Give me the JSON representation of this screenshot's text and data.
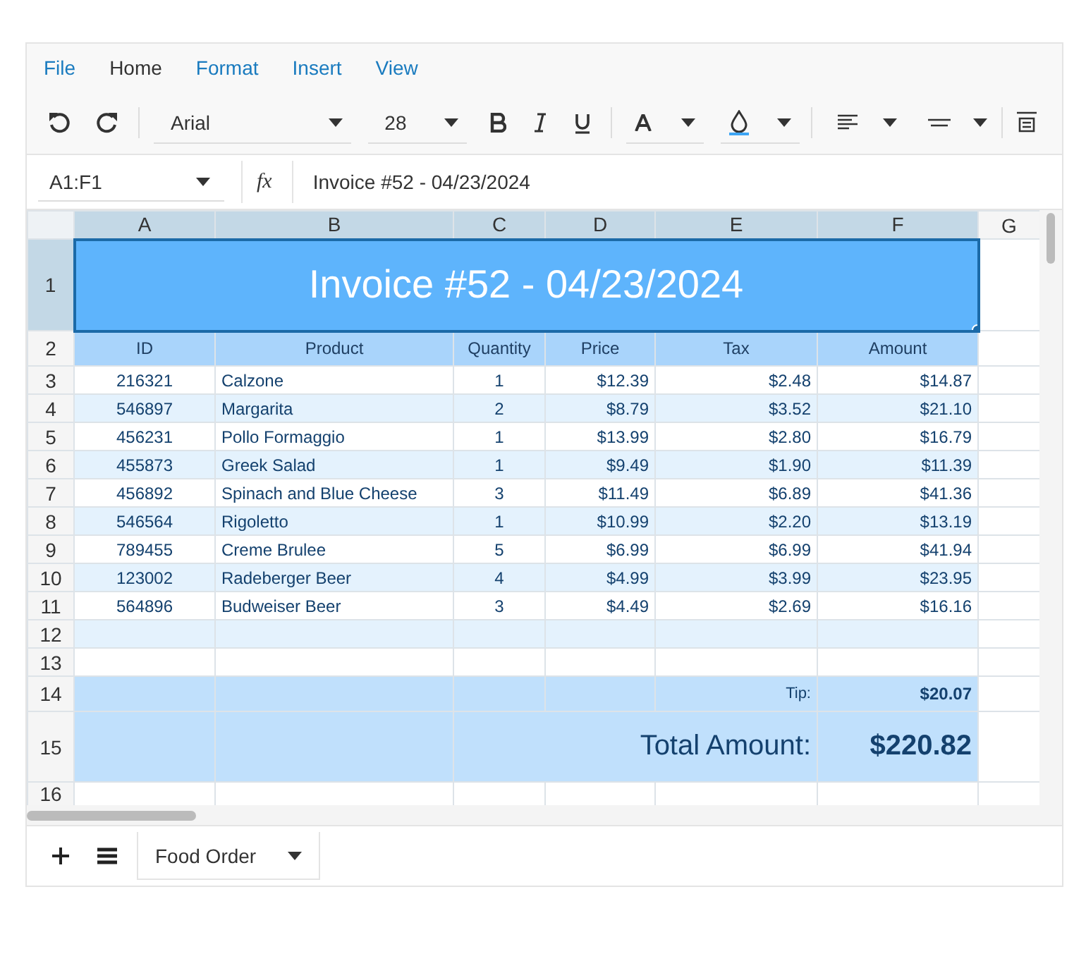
{
  "menu": [
    {
      "label": "File",
      "selected": false
    },
    {
      "label": "Home",
      "selected": true
    },
    {
      "label": "Format",
      "selected": false
    },
    {
      "label": "Insert",
      "selected": false
    },
    {
      "label": "View",
      "selected": false
    }
  ],
  "toolbar": {
    "font": "Arial",
    "font_size": "28"
  },
  "formula_bar": {
    "name_box": "A1:F1",
    "fx": "fx",
    "value": "Invoice #52 - 04/23/2024"
  },
  "columns": [
    {
      "label": "A",
      "selected": true
    },
    {
      "label": "B",
      "selected": true
    },
    {
      "label": "C",
      "selected": true
    },
    {
      "label": "D",
      "selected": true
    },
    {
      "label": "E",
      "selected": true
    },
    {
      "label": "F",
      "selected": true
    },
    {
      "label": "G",
      "selected": false
    }
  ],
  "row_numbers": [
    {
      "label": "1",
      "selected": true
    },
    {
      "label": "2",
      "selected": false
    },
    {
      "label": "3",
      "selected": false
    },
    {
      "label": "4",
      "selected": false
    },
    {
      "label": "5",
      "selected": false
    },
    {
      "label": "6",
      "selected": false
    },
    {
      "label": "7",
      "selected": false
    },
    {
      "label": "8",
      "selected": false
    },
    {
      "label": "9",
      "selected": false
    },
    {
      "label": "10",
      "selected": false
    },
    {
      "label": "11",
      "selected": false
    },
    {
      "label": "12",
      "selected": false
    },
    {
      "label": "13",
      "selected": false
    },
    {
      "label": "14",
      "selected": false
    },
    {
      "label": "15",
      "selected": false
    },
    {
      "label": "16",
      "selected": false
    }
  ],
  "title": "Invoice #52 - 04/23/2024",
  "headers": [
    "ID",
    "Product",
    "Quantity",
    "Price",
    "Tax",
    "Amount"
  ],
  "rows": [
    [
      "216321",
      "Calzone",
      "1",
      "$12.39",
      "$2.48",
      "$14.87"
    ],
    [
      "546897",
      "Margarita",
      "2",
      "$8.79",
      "$3.52",
      "$21.10"
    ],
    [
      "456231",
      "Pollo Formaggio",
      "1",
      "$13.99",
      "$2.80",
      "$16.79"
    ],
    [
      "455873",
      "Greek Salad",
      "1",
      "$9.49",
      "$1.90",
      "$11.39"
    ],
    [
      "456892",
      "Spinach and Blue Cheese",
      "3",
      "$11.49",
      "$6.89",
      "$41.36"
    ],
    [
      "546564",
      "Rigoletto",
      "1",
      "$10.99",
      "$2.20",
      "$13.19"
    ],
    [
      "789455",
      "Creme Brulee",
      "5",
      "$6.99",
      "$6.99",
      "$41.94"
    ],
    [
      "123002",
      "Radeberger Beer",
      "4",
      "$4.99",
      "$3.99",
      "$23.95"
    ],
    [
      "564896",
      "Budweiser Beer",
      "3",
      "$4.49",
      "$2.69",
      "$16.16"
    ]
  ],
  "tip": {
    "label": "Tip:",
    "value": "$20.07"
  },
  "total": {
    "label": "Total Amount:",
    "value": "$220.82"
  },
  "sheet_tabs": [
    {
      "label": "Food Order",
      "selected": true
    }
  ]
}
